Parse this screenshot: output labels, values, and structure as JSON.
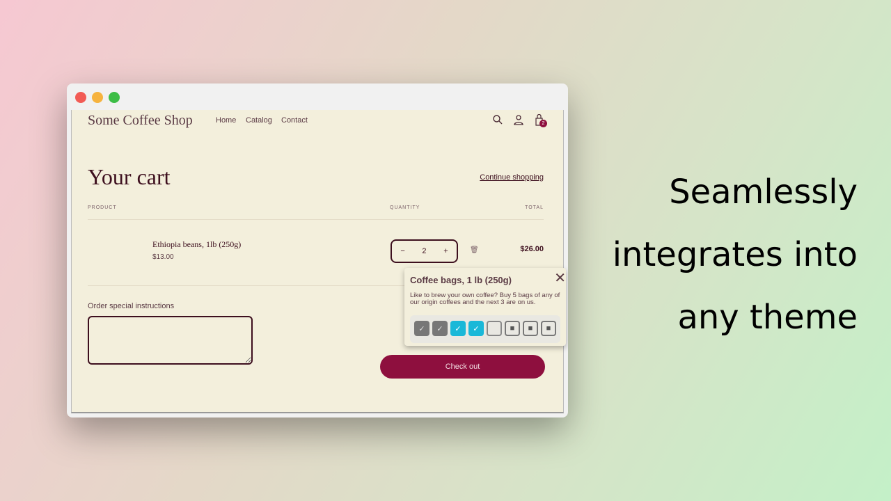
{
  "shop": {
    "name": "Some Coffee Shop",
    "nav": [
      "Home",
      "Catalog",
      "Contact"
    ],
    "cart_count": "2"
  },
  "cart": {
    "title": "Your cart",
    "continue": "Continue shopping",
    "headers": {
      "product": "PRODUCT",
      "quantity": "QUANTITY",
      "total": "TOTAL"
    },
    "item": {
      "name": "Ethiopia beans, 1lb (250g)",
      "price": "$13.00",
      "qty": "2",
      "total": "$26.00"
    },
    "instructions_label": "Order special instructions",
    "checkout": "Check out"
  },
  "popup": {
    "title": "Coffee bags, 1 lb (250g)",
    "text": "Like to brew your own coffee? Buy 5 bags of any of our origin coffees and the next 3 are on us.",
    "slots": [
      "filled",
      "filled",
      "selected",
      "selected",
      "empty",
      "gift",
      "gift",
      "gift"
    ]
  },
  "tagline": [
    "Seamlessly",
    "integrates into",
    "any theme"
  ],
  "colors": {
    "accent": "#8e0f3e",
    "text": "#3d0f1e",
    "background": "#f3efdc",
    "selected": "#1ab8d8"
  }
}
